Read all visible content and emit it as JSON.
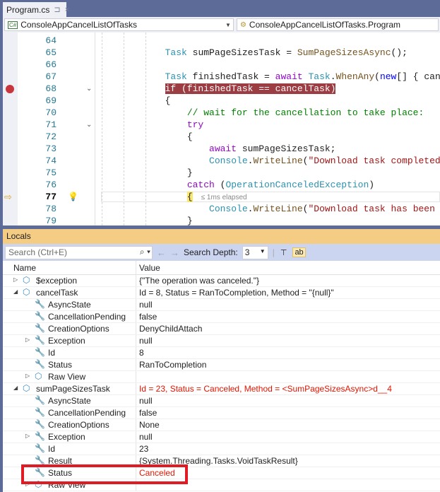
{
  "tab": {
    "title": "Program.cs",
    "pin": "⊐",
    "close": "×"
  },
  "nav": {
    "project": "ConsoleAppCancelListOfTasks",
    "type": "ConsoleAppCancelListOfTasks.Program",
    "project_icon": "C#"
  },
  "editor": {
    "lines": [
      {
        "n": "64",
        "tokens": []
      },
      {
        "n": "65",
        "tokens": [
          {
            "t": "            "
          },
          {
            "t": "Task",
            "c": "ty"
          },
          {
            "t": " sumPageSizesTask = ",
            "c": "pl"
          },
          {
            "t": "SumPageSizesAsync",
            "c": "me"
          },
          {
            "t": "();",
            "c": "pl"
          }
        ]
      },
      {
        "n": "66",
        "tokens": []
      },
      {
        "n": "67",
        "tokens": [
          {
            "t": "            "
          },
          {
            "t": "Task",
            "c": "ty"
          },
          {
            "t": " finishedTask = ",
            "c": "pl"
          },
          {
            "t": "await",
            "c": "ct"
          },
          {
            "t": " "
          },
          {
            "t": "Task",
            "c": "ty"
          },
          {
            "t": ".",
            "c": "pl"
          },
          {
            "t": "WhenAny",
            "c": "me"
          },
          {
            "t": "(",
            "c": "pl"
          },
          {
            "t": "new",
            "c": "kw"
          },
          {
            "t": "[] { canc",
            "c": "pl"
          }
        ]
      },
      {
        "n": "68",
        "tokens": [
          {
            "t": "            "
          },
          {
            "t": "if (finishedTask == cancelTask)",
            "c": "hlbp"
          }
        ],
        "breakpoint": true
      },
      {
        "n": "69",
        "tokens": [
          {
            "t": "            "
          },
          {
            "t": "{",
            "c": "pl"
          }
        ]
      },
      {
        "n": "70",
        "tokens": [
          {
            "t": "                "
          },
          {
            "t": "// wait for the cancellation to take place:",
            "c": "cm"
          }
        ]
      },
      {
        "n": "71",
        "tokens": [
          {
            "t": "                "
          },
          {
            "t": "try",
            "c": "ct"
          }
        ]
      },
      {
        "n": "72",
        "tokens": [
          {
            "t": "                "
          },
          {
            "t": "{",
            "c": "pl"
          }
        ]
      },
      {
        "n": "73",
        "tokens": [
          {
            "t": "                    "
          },
          {
            "t": "await",
            "c": "ct"
          },
          {
            "t": " sumPageSizesTask;",
            "c": "pl"
          }
        ]
      },
      {
        "n": "74",
        "tokens": [
          {
            "t": "                    "
          },
          {
            "t": "Console",
            "c": "ty"
          },
          {
            "t": ".",
            "c": "pl"
          },
          {
            "t": "WriteLine",
            "c": "me"
          },
          {
            "t": "(",
            "c": "pl"
          },
          {
            "t": "\"Download task completed (",
            "c": "st"
          }
        ]
      },
      {
        "n": "75",
        "tokens": [
          {
            "t": "                "
          },
          {
            "t": "}",
            "c": "pl"
          }
        ]
      },
      {
        "n": "76",
        "tokens": [
          {
            "t": "                "
          },
          {
            "t": "catch",
            "c": "ct"
          },
          {
            "t": " (",
            "c": "pl"
          },
          {
            "t": "OperationCanceledException",
            "c": "ty"
          },
          {
            "t": ")",
            "c": "pl"
          }
        ]
      },
      {
        "n": "77",
        "tokens": [
          {
            "t": "                "
          },
          {
            "t": "{",
            "c": "hlcur"
          }
        ],
        "current": true,
        "hint": "≤ 1ms elapsed"
      },
      {
        "n": "78",
        "tokens": [
          {
            "t": "                    "
          },
          {
            "t": "Console",
            "c": "ty"
          },
          {
            "t": ".",
            "c": "pl"
          },
          {
            "t": "WriteLine",
            "c": "me"
          },
          {
            "t": "(",
            "c": "pl"
          },
          {
            "t": "\"Download task has been ca",
            "c": "st"
          }
        ]
      },
      {
        "n": "79",
        "tokens": [
          {
            "t": "                "
          },
          {
            "t": "}",
            "c": "pl"
          }
        ]
      }
    ]
  },
  "locals": {
    "title": "Locals",
    "search_placeholder": "Search (Ctrl+E)",
    "search_depth_label": "Search Depth:",
    "search_depth": "3",
    "columns": {
      "name": "Name",
      "value": "Value"
    },
    "rows": [
      {
        "name": "$exception",
        "value": "{\"The operation was canceled.\"}",
        "level": 0,
        "icon": "object",
        "exp": "closed"
      },
      {
        "name": "cancelTask",
        "value": "Id = 8, Status = RanToCompletion, Method = \"{null}\"",
        "level": 0,
        "icon": "object",
        "exp": "open"
      },
      {
        "name": "AsyncState",
        "value": "null",
        "level": 1,
        "icon": "wrench"
      },
      {
        "name": "CancellationPending",
        "value": "false",
        "level": 1,
        "icon": "wrench"
      },
      {
        "name": "CreationOptions",
        "value": "DenyChildAttach",
        "level": 1,
        "icon": "wrench"
      },
      {
        "name": "Exception",
        "value": "null",
        "level": 1,
        "icon": "wrench",
        "exp": "closed"
      },
      {
        "name": "Id",
        "value": "8",
        "level": 1,
        "icon": "wrench"
      },
      {
        "name": "Status",
        "value": "RanToCompletion",
        "level": 1,
        "icon": "wrench"
      },
      {
        "name": "Raw View",
        "value": "",
        "level": 1,
        "icon": "object",
        "exp": "closed"
      },
      {
        "name": "sumPageSizesTask",
        "value": "Id = 23, Status = Canceled, Method = <SumPageSizesAsync>d__4",
        "level": 0,
        "icon": "object",
        "exp": "open",
        "changed": true
      },
      {
        "name": "AsyncState",
        "value": "null",
        "level": 1,
        "icon": "wrench"
      },
      {
        "name": "CancellationPending",
        "value": "false",
        "level": 1,
        "icon": "wrench"
      },
      {
        "name": "CreationOptions",
        "value": "None",
        "level": 1,
        "icon": "wrench"
      },
      {
        "name": "Exception",
        "value": "null",
        "level": 1,
        "icon": "wrench",
        "exp": "closed"
      },
      {
        "name": "Id",
        "value": "23",
        "level": 1,
        "icon": "wrench"
      },
      {
        "name": "Result",
        "value": "{System.Threading.Tasks.VoidTaskResult}",
        "level": 1,
        "icon": "wrench"
      },
      {
        "name": "Status",
        "value": "Canceled",
        "level": 1,
        "icon": "wrench",
        "changed": true
      },
      {
        "name": "Raw View",
        "value": "",
        "level": 1,
        "icon": "object",
        "exp": "closed"
      }
    ]
  }
}
